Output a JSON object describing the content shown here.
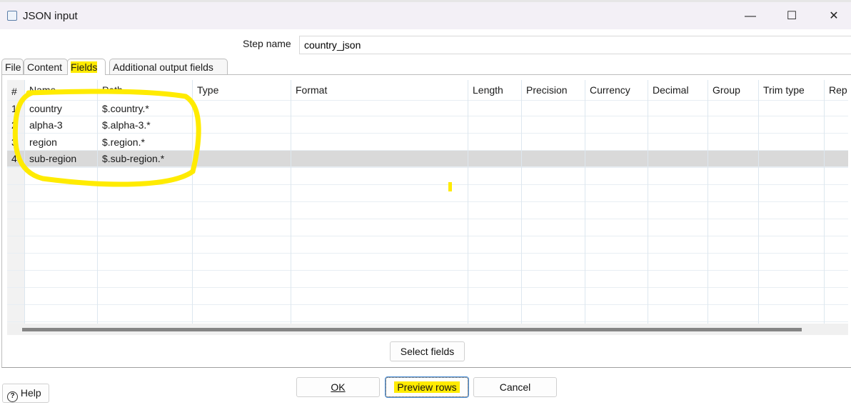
{
  "window": {
    "title": "JSON input",
    "icon": "json-input-step-icon",
    "controls": {
      "minimize": "—",
      "maximize": "☐",
      "close": "✕"
    }
  },
  "step": {
    "label": "Step name",
    "value": "country_json"
  },
  "tabs": [
    {
      "label": "File"
    },
    {
      "label": "Content"
    },
    {
      "label": "Fields",
      "active": true
    },
    {
      "label": "Additional output fields"
    }
  ],
  "table": {
    "columns": [
      "#",
      "Name",
      "Path",
      "Type",
      "Format",
      "Length",
      "Precision",
      "Currency",
      "Decimal",
      "Group",
      "Trim type",
      "Rep"
    ],
    "rows": [
      {
        "num": "1",
        "name": "country",
        "path": "$.country.*"
      },
      {
        "num": "2",
        "name": "alpha-3",
        "path": "$.alpha-3.*"
      },
      {
        "num": "3",
        "name": "region",
        "path": "$.region.*"
      },
      {
        "num": "4",
        "name": "sub-region",
        "path": "$.sub-region.*",
        "selected": true
      }
    ]
  },
  "buttons": {
    "select_fields": "Select fields",
    "ok": "OK",
    "preview": "Preview rows",
    "cancel": "Cancel",
    "help": "Help"
  },
  "colors": {
    "highlight": "#ffeb00",
    "selected_row": "#d9d9d9"
  }
}
